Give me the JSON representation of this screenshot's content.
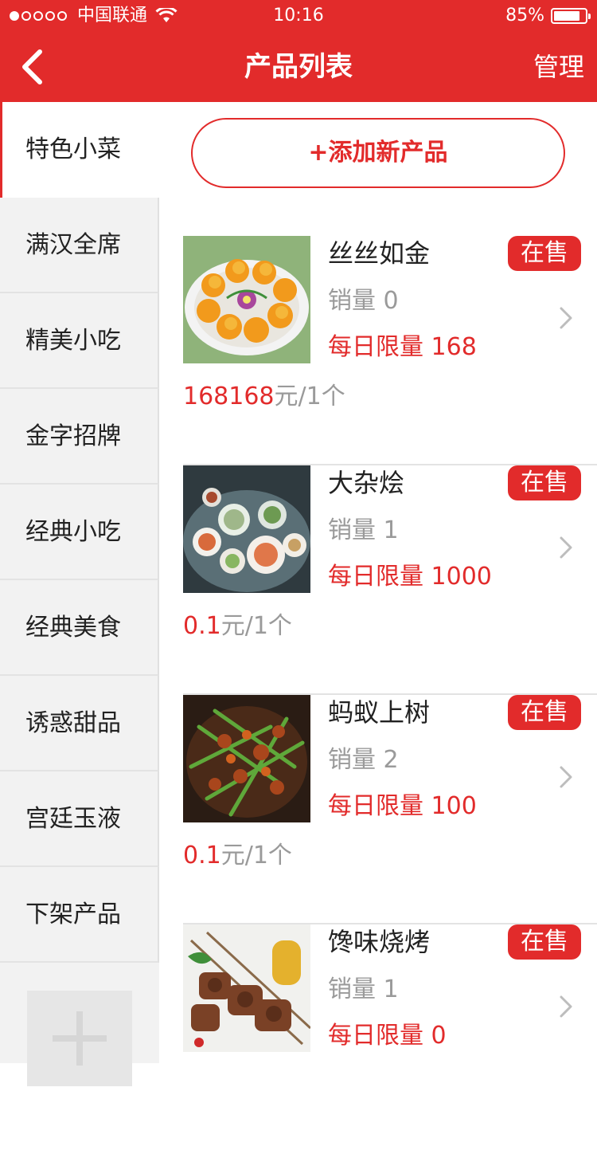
{
  "status_bar": {
    "carrier": "中国联通",
    "time": "10:16",
    "battery": "85%"
  },
  "nav": {
    "title": "产品列表",
    "manage_label": "管理"
  },
  "sidebar": {
    "items": [
      {
        "label": "特色小菜"
      },
      {
        "label": "满汉全席"
      },
      {
        "label": "精美小吃"
      },
      {
        "label": "金字招牌"
      },
      {
        "label": "经典小吃"
      },
      {
        "label": "经典美食"
      },
      {
        "label": "诱惑甜品"
      },
      {
        "label": "宫廷玉液"
      },
      {
        "label": "下架产品"
      }
    ],
    "add_icon": "plus-icon"
  },
  "main": {
    "add_button_label": "+添加新产品",
    "products": [
      {
        "name": "丝丝如金",
        "status": "在售",
        "sales": "销量 0",
        "limit": "每日限量 168",
        "price": "168168",
        "unit": "元/1个"
      },
      {
        "name": "大杂烩",
        "status": "在售",
        "sales": "销量 1",
        "limit": "每日限量 1000",
        "price": "0.1",
        "unit": "元/1个"
      },
      {
        "name": "蚂蚁上树",
        "status": "在售",
        "sales": "销量 2",
        "limit": "每日限量 100",
        "price": "0.1",
        "unit": "元/1个"
      },
      {
        "name": "馋味烧烤",
        "status": "在售",
        "sales": "销量 1",
        "limit": "每日限量 0",
        "price": "",
        "unit": ""
      }
    ]
  },
  "colors": {
    "brand_red": "#e22b2b",
    "sidebar_bg": "#f2f2f2",
    "muted_text": "#9a9a9a"
  }
}
